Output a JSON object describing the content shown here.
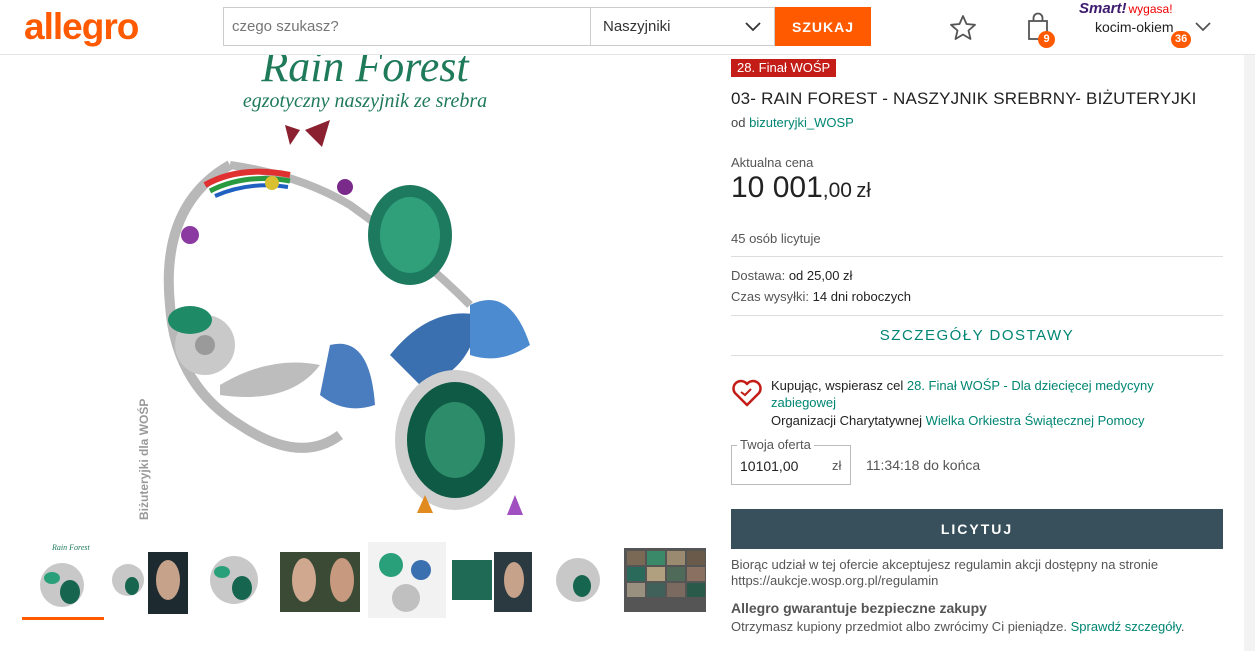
{
  "header": {
    "logo": "allegro",
    "search_placeholder": "czego szukasz?",
    "category": "Naszyjniki",
    "search_button": "SZUKAJ",
    "cart_count": "9",
    "smart_label": "Smart!",
    "smart_status": "wygasa!",
    "username": "kocim-okiem",
    "user_count": "36"
  },
  "gallery": {
    "title_text": "Rain Forest",
    "subtitle_text": "egzotyczny naszyjnik ze srebra",
    "watermark": "Biżuteryjki dla WOŚP"
  },
  "product": {
    "badge": "28. Finał WOŚP",
    "title": "03- RAIN FOREST - NASZYJNIK SREBRNY- BIŻUTERYJKI",
    "seller_prefix": "od",
    "seller": "bizuteryjki_WOSP",
    "price_label": "Aktualna cena",
    "price_main": "10 001",
    "price_cents": ",00",
    "price_currency": "zł",
    "bidders": "45 osób licytuje",
    "delivery_label": "Dostawa:",
    "delivery_value": "od 25,00 zł",
    "dispatch_label": "Czas wysyłki:",
    "dispatch_value": "14 dni roboczych",
    "delivery_details": "SZCZEGÓŁY DOSTAWY",
    "charity_prefix": "Kupując, wspierasz cel",
    "charity_link": "28. Finał WOŚP - Dla dziecięcej medycyny zabiegowej",
    "org_prefix": "Organizacji Charytatywnej",
    "org_link": "Wielka Orkiestra Świątecznej Pomocy",
    "offer_label": "Twoja oferta",
    "offer_value": "10101,00",
    "offer_currency": "zł",
    "countdown": "11:34:18 do końca",
    "bid_button": "LICYTUJ",
    "terms": "Biorąc udział w tej ofercie akceptujesz regulamin akcji dostępny na stronie https://aukcje.wosp.org.pl/regulamin",
    "guarantee_title": "Allegro gwarantuje bezpieczne zakupy",
    "guarantee_text": "Otrzymasz kupiony przedmiot albo zwrócimy Ci pieniądze.",
    "guarantee_link": "Sprawdź szczegóły",
    "guarantee_end": "."
  },
  "colors": {
    "brand": "#ff5a00",
    "accent": "#008673",
    "bid_button": "#37505b",
    "badge_red": "#c41c17"
  }
}
